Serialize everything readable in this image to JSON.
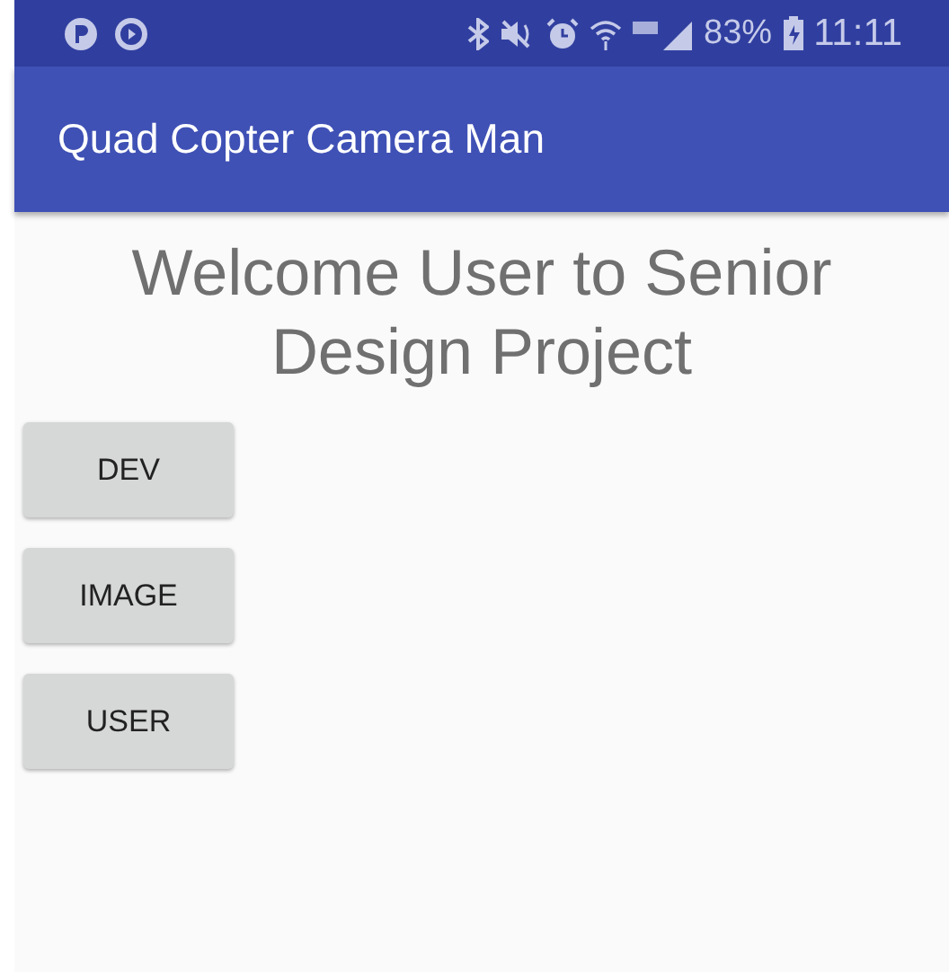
{
  "status_bar": {
    "battery": "83%",
    "time": "11:11"
  },
  "app_bar": {
    "title": "Quad Copter Camera Man"
  },
  "welcome": "Welcome User to Senior Design Project",
  "buttons": [
    {
      "label": "DEV"
    },
    {
      "label": "IMAGE"
    },
    {
      "label": "USER"
    }
  ]
}
